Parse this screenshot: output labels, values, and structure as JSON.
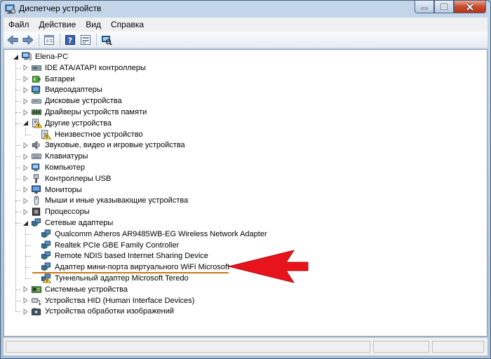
{
  "window": {
    "title": "Диспетчер устройств"
  },
  "menu": [
    "Файл",
    "Действие",
    "Вид",
    "Справка"
  ],
  "toolbar": [
    "back-icon",
    "forward-icon",
    "properties-icon",
    "help-icon",
    "view-icon",
    "scan-hardware-icon"
  ],
  "tree": [
    {
      "label": "Elena-PC",
      "level": 0,
      "expander": "open",
      "icon": "computer-icon",
      "name": "tree-root-elena-pc"
    },
    {
      "label": "IDE ATA/ATAPI контроллеры",
      "level": 1,
      "expander": "closed",
      "icon": "ide-controller-icon",
      "name": "tree-item-ide"
    },
    {
      "label": "Батареи",
      "level": 1,
      "expander": "closed",
      "icon": "battery-icon",
      "name": "tree-item-batteries"
    },
    {
      "label": "Видеоадаптеры",
      "level": 1,
      "expander": "closed",
      "icon": "display-adapter-icon",
      "name": "tree-item-video"
    },
    {
      "label": "Дисковые устройства",
      "level": 1,
      "expander": "closed",
      "icon": "disk-drive-icon",
      "name": "tree-item-disks"
    },
    {
      "label": "Драйверы устройств памяти",
      "level": 1,
      "expander": "closed",
      "icon": "memory-device-icon",
      "name": "tree-item-memory"
    },
    {
      "label": "Другие устройства",
      "level": 1,
      "expander": "open",
      "icon": "other-devices-icon",
      "name": "tree-item-other"
    },
    {
      "label": "Неизвестное устройство",
      "level": 2,
      "expander": "none",
      "icon": "unknown-device-warning-icon",
      "name": "tree-item-unknown-device"
    },
    {
      "label": "Звуковые, видео и игровые устройства",
      "level": 1,
      "expander": "closed",
      "icon": "sound-icon",
      "name": "tree-item-sound"
    },
    {
      "label": "Клавиатуры",
      "level": 1,
      "expander": "closed",
      "icon": "keyboard-icon",
      "name": "tree-item-keyboards"
    },
    {
      "label": "Компьютер",
      "level": 1,
      "expander": "closed",
      "icon": "computer-small-icon",
      "name": "tree-item-computer"
    },
    {
      "label": "Контроллеры USB",
      "level": 1,
      "expander": "closed",
      "icon": "usb-icon",
      "name": "tree-item-usb"
    },
    {
      "label": "Мониторы",
      "level": 1,
      "expander": "closed",
      "icon": "monitor-icon",
      "name": "tree-item-monitors"
    },
    {
      "label": "Мыши и иные указывающие устройства",
      "level": 1,
      "expander": "closed",
      "icon": "mouse-icon",
      "name": "tree-item-mice"
    },
    {
      "label": "Процессоры",
      "level": 1,
      "expander": "closed",
      "icon": "processor-icon",
      "name": "tree-item-processors"
    },
    {
      "label": "Сетевые адаптеры",
      "level": 1,
      "expander": "open",
      "icon": "network-adapter-icon",
      "name": "tree-item-network"
    },
    {
      "label": "Qualcomm Atheros AR9485WB-EG Wireless Network Adapter",
      "level": 2,
      "expander": "none",
      "icon": "network-adapter-icon",
      "name": "tree-item-qualcomm"
    },
    {
      "label": "Realtek PCIe GBE Family Controller",
      "level": 2,
      "expander": "none",
      "icon": "network-adapter-icon",
      "name": "tree-item-realtek"
    },
    {
      "label": "Remote NDIS based Internet Sharing Device",
      "level": 2,
      "expander": "none",
      "icon": "network-adapter-icon",
      "name": "tree-item-ndis"
    },
    {
      "label": "Адаптер мини-порта виртуального WiFi Microsoft",
      "level": 2,
      "expander": "none",
      "icon": "network-adapter-icon",
      "name": "tree-item-virtual-wifi"
    },
    {
      "label": "Туннельный адаптер Microsoft Teredo",
      "level": 2,
      "expander": "none",
      "icon": "network-adapter-warning-icon",
      "name": "tree-item-teredo"
    },
    {
      "label": "Системные устройства",
      "level": 1,
      "expander": "closed",
      "icon": "system-devices-icon",
      "name": "tree-item-system"
    },
    {
      "label": "Устройства HID (Human Interface Devices)",
      "level": 1,
      "expander": "closed",
      "icon": "hid-icon",
      "name": "tree-item-hid"
    },
    {
      "label": "Устройства обработки изображений",
      "level": 1,
      "expander": "closed",
      "icon": "imaging-icon",
      "name": "tree-item-imaging"
    }
  ],
  "annotation": {
    "arrow_color": "#e8141c",
    "underline_color": "#c87a12"
  }
}
